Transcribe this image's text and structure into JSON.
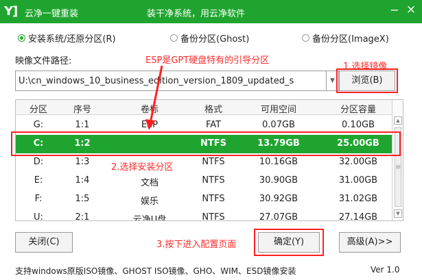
{
  "window": {
    "logo_text": "Y]",
    "title": "云净一键重装",
    "slogan": "装干净系统，用云净软件",
    "minimize_label": "−",
    "close_label": "×"
  },
  "modes": [
    {
      "label": "安装系统/还原分区(R)",
      "selected": true
    },
    {
      "label": "备份分区(Ghost)",
      "selected": false
    },
    {
      "label": "备份分区(ImageX)",
      "selected": false
    }
  ],
  "image_path": {
    "label": "映像文件路径:",
    "value": "U:\\cn_windows_10_business_edition_version_1809_updated_s",
    "dropdown_icon": "chevron-down-icon",
    "browse_label": "浏览(B)"
  },
  "annotations": {
    "esp_note": "ESP是GPT硬盘特有的引导分区",
    "step1": "1.选择镜像",
    "step2": "2.选择安装分区",
    "step3": "3.按下进入配置页面",
    "annotation_color": "#ff2020"
  },
  "table": {
    "columns": [
      "分区",
      "序号",
      "卷标",
      "格式",
      "可用空间",
      "分区容量"
    ],
    "rows": [
      {
        "drive": "G:",
        "index": "1:1",
        "label": "ESP",
        "format": "FAT",
        "free": "0.07GB",
        "size": "0.10GB",
        "selected": false
      },
      {
        "drive": "C:",
        "index": "1:2",
        "label": "",
        "format": "NTFS",
        "free": "13.79GB",
        "size": "25.00GB",
        "selected": true
      },
      {
        "drive": "D:",
        "index": "1:3",
        "label": "",
        "format": "NTFS",
        "free": "10.16GB",
        "size": "32.00GB",
        "selected": false
      },
      {
        "drive": "E:",
        "index": "1:4",
        "label": "文档",
        "format": "NTFS",
        "free": "30.90GB",
        "size": "31.00GB",
        "selected": false
      },
      {
        "drive": "F:",
        "index": "1:5",
        "label": "娱乐",
        "format": "NTFS",
        "free": "30.92GB",
        "size": "31.02GB",
        "selected": false
      },
      {
        "drive": "U:",
        "index": "2:1",
        "label": "云净U盘",
        "format": "NTFS",
        "free": "27.07GB",
        "size": "27.14GB",
        "selected": false
      }
    ]
  },
  "buttons": {
    "close": "关闭(C)",
    "confirm": "确定(Y)",
    "advanced": "高级(A)>>"
  },
  "footer": {
    "support": "支持windows原版ISO镜像、GHOST ISO镜像、GHO、WIM、ESD镜像安装",
    "version": "Ver 1.0"
  },
  "colors": {
    "accent": "#1fa52f",
    "annotation": "#ff2020"
  }
}
